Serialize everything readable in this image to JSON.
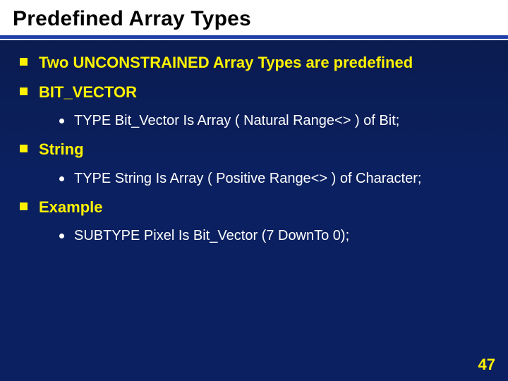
{
  "title": "Predefined Array Types",
  "items": [
    {
      "text": "Two UNCONSTRAINED Array Types are predefined",
      "sub": null
    },
    {
      "text": "BIT_VECTOR",
      "sub": "TYPE Bit_Vector  Is Array ( Natural Range<> ) of Bit;"
    },
    {
      "text": "String",
      "sub": "TYPE String  Is Array ( Positive  Range<> ) of  Character;"
    },
    {
      "text": "Example",
      "sub": "SUBTYPE  Pixel  Is Bit_Vector (7 DownTo 0);"
    }
  ],
  "page_number": "47"
}
